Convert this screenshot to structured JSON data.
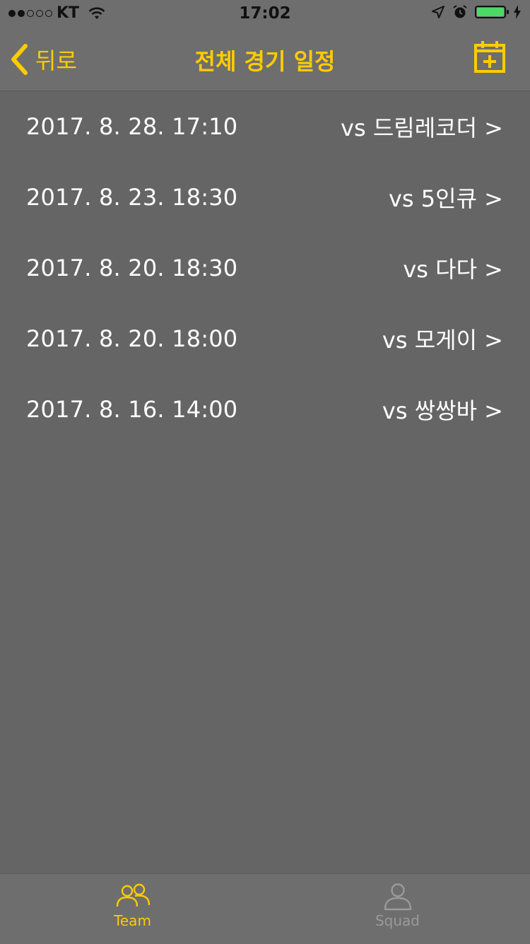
{
  "status_bar": {
    "carrier": "KT",
    "time": "17:02",
    "signal_bars_filled": 2,
    "signal_bars_total": 5,
    "battery_color": "#4cd964",
    "icons": [
      "wifi-icon",
      "location-arrow-icon",
      "alarm-icon",
      "battery-icon",
      "charging-bolt-icon"
    ]
  },
  "nav": {
    "back_label": "뒤로",
    "title": "전체 경기 일정",
    "accent_color": "#ffcc00",
    "add_icon": "calendar-add-icon"
  },
  "matches": [
    {
      "date": "2017. 8. 28. 17:10",
      "opponent": "vs 드림레코더 >"
    },
    {
      "date": "2017. 8. 23. 18:30",
      "opponent": "vs 5인큐 >"
    },
    {
      "date": "2017. 8. 20. 18:30",
      "opponent": "vs 다다 >"
    },
    {
      "date": "2017. 8. 20. 18:00",
      "opponent": "vs 모게이 >"
    },
    {
      "date": "2017. 8. 16. 14:00",
      "opponent": "vs 쌍쌍바 >"
    }
  ],
  "tab_bar": {
    "tabs": [
      {
        "label": "Team",
        "icon": "team-icon",
        "active": true
      },
      {
        "label": "Squad",
        "icon": "squad-icon",
        "active": false
      }
    ]
  }
}
